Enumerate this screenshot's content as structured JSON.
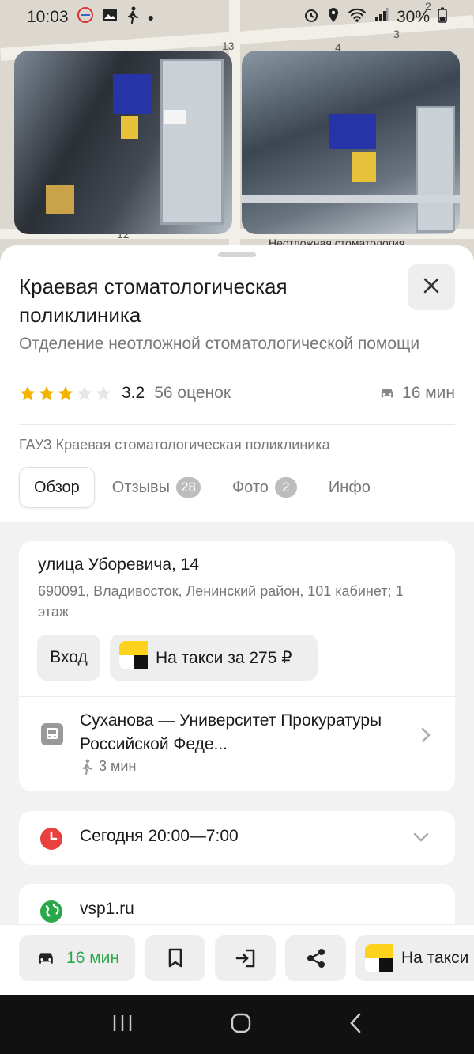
{
  "status_bar": {
    "time": "10:03",
    "battery": "30%"
  },
  "map": {
    "labels": [
      "13",
      "4",
      "3",
      "2",
      "12"
    ],
    "photo_caption": "Неотложная стоматология"
  },
  "place": {
    "title": "Краевая стоматологическая поликлиника",
    "subtitle": "Отделение неотложной стоматологической помощи",
    "rating_value": "3.2",
    "rating_stars": 3,
    "rating_count": "56 оценок",
    "drive_time": "16 мин",
    "organization": "ГАУЗ Краевая стоматологическая поликлиника"
  },
  "tabs": [
    {
      "label": "Обзор",
      "badge": ""
    },
    {
      "label": "Отзывы",
      "badge": "28"
    },
    {
      "label": "Фото",
      "badge": "2"
    },
    {
      "label": "Инфо",
      "badge": ""
    }
  ],
  "address": {
    "street": "улица Уборевича, 14",
    "details": "690091, Владивосток, Ленинский район, 101 кабинет; 1 этаж",
    "entrance_label": "Вход",
    "taxi_label": "На такси за 275 ₽"
  },
  "transit": {
    "stop": "Суханова — Университет Прокуратуры Российской Феде...",
    "walk_time": "3 мин"
  },
  "hours": {
    "text": "Сегодня 20:00—7:00"
  },
  "website": {
    "text": "vsp1.ru"
  },
  "action_bar": {
    "drive_label": "16 мин",
    "taxi_label": "На такси"
  },
  "colors": {
    "star": "#f5b301",
    "accent_green": "#27a84a",
    "clock_red": "#e8413e",
    "globe_green": "#2aa84a"
  }
}
